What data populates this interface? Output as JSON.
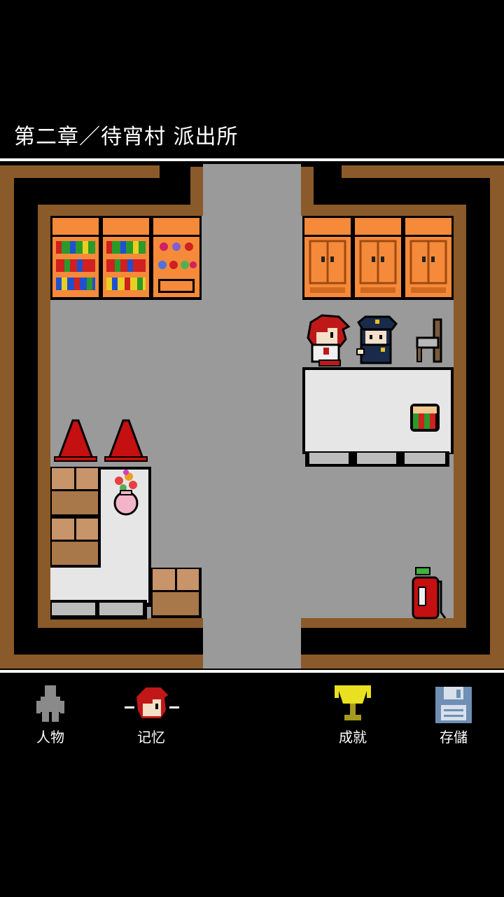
{
  "location_title": "第二章／待宵村 派出所",
  "colors": {
    "floor": "#9a9a9a",
    "wall_wood": "#8a5a2a",
    "wall_dark": "#000000",
    "shelf_orange": "#f58a3a",
    "table_top": "#e6e6e6",
    "cone_red": "#c41010",
    "trophy_yellow": "#e8e020",
    "disk_blue": "#6f8fb4"
  },
  "menu": {
    "characters": {
      "label": "人物",
      "icon": "person-silhouette-icon"
    },
    "memory": {
      "label": "记忆",
      "icon": "red-haired-girl-portrait-icon"
    },
    "achievements": {
      "label": "成就",
      "icon": "trophy-icon"
    },
    "save": {
      "label": "存儲",
      "icon": "floppy-disk-icon"
    }
  }
}
